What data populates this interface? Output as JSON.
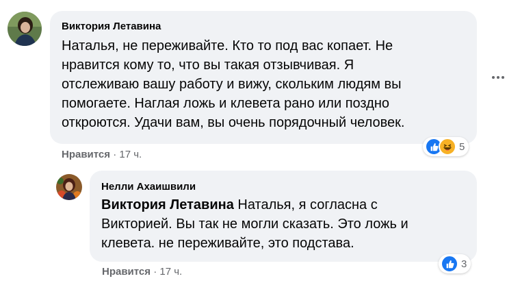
{
  "comment": {
    "author": "Виктория Летавина",
    "lines": [
      "Наталья, не переживайте. Кто то под вас копает. Не",
      "нравится кому то, что вы такая отзывчивая. Я",
      "отслеживаю вашу работу и вижу, скольким людям вы",
      "помогаете. Наглая ложь и клевета рано или поздно",
      "откроются. Удачи вам, вы очень порядочный человек."
    ],
    "like_label": "Нравится",
    "separator": "·",
    "time": "17 ч.",
    "reactions": [
      "like-icon",
      "haha-icon"
    ],
    "reaction_count": "5",
    "colors": {
      "like": "#1877f2",
      "haha": "#f7b125"
    }
  },
  "reply": {
    "author": "Нелли Ахаишвили",
    "mention": "Виктория Летавина",
    "line1": "Наталья, я согласна с",
    "lines": [
      "Викторией. Вы так не могли сказать. Это ложь и",
      "клевета. не переживайте, это подстава."
    ],
    "like_label": "Нравится",
    "separator": "·",
    "time": "17 ч.",
    "reactions": [
      "like-icon"
    ],
    "reaction_count": "3"
  },
  "more_options": "more-options-icon"
}
